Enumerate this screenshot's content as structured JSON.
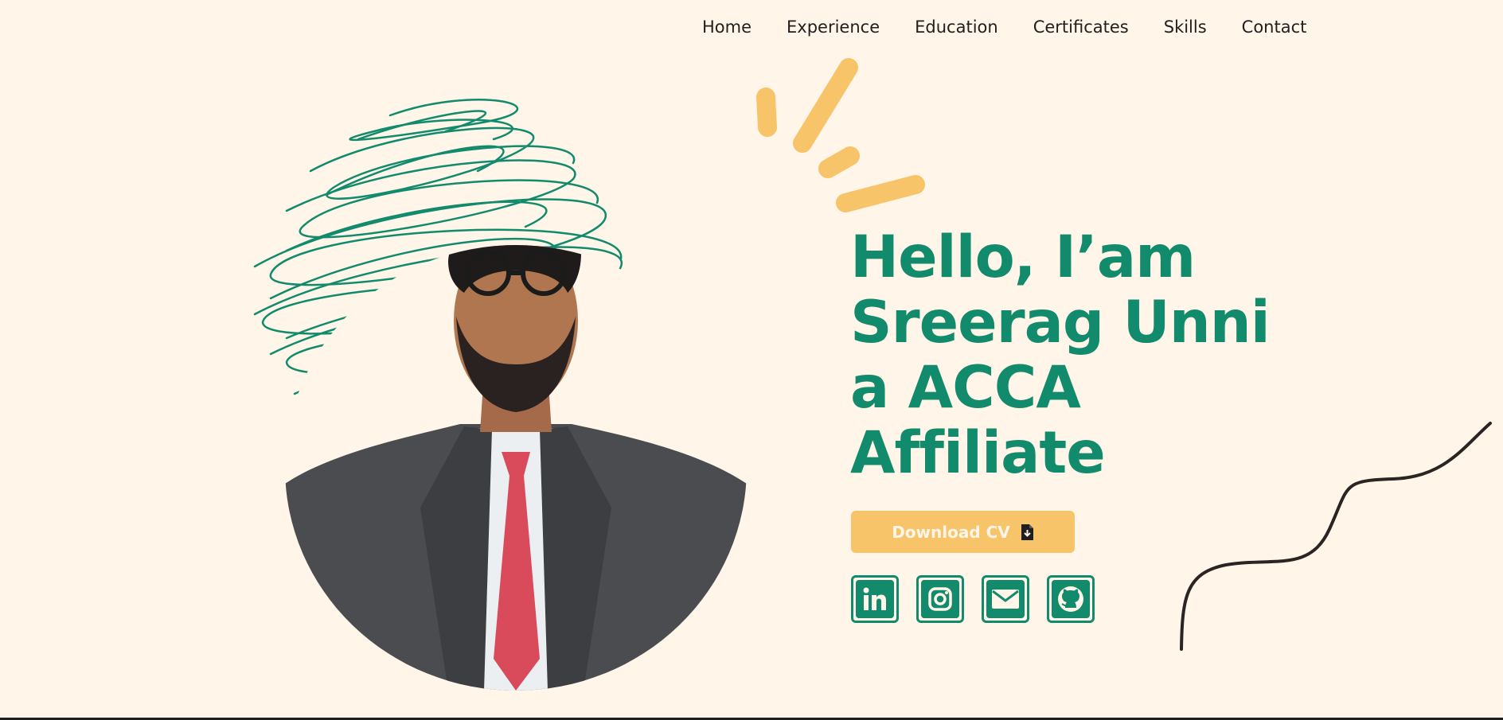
{
  "nav": {
    "items": [
      "Home",
      "Experience",
      "Education",
      "Certificates",
      "Skills",
      "Contact"
    ]
  },
  "hero": {
    "lines": [
      "Hello, I’am",
      "Sreerag Unni",
      "a ACCA",
      "Affiliate"
    ],
    "cta_label": "Download CV",
    "cta_icon": "file-download-icon",
    "socials": [
      "linkedin-icon",
      "instagram-icon",
      "mail-icon",
      "github-icon"
    ]
  },
  "colors": {
    "background": "#fff5e8",
    "accent_green": "#128a6c",
    "accent_yellow": "#f8c46a",
    "text_dark": "#1f1f1f"
  }
}
